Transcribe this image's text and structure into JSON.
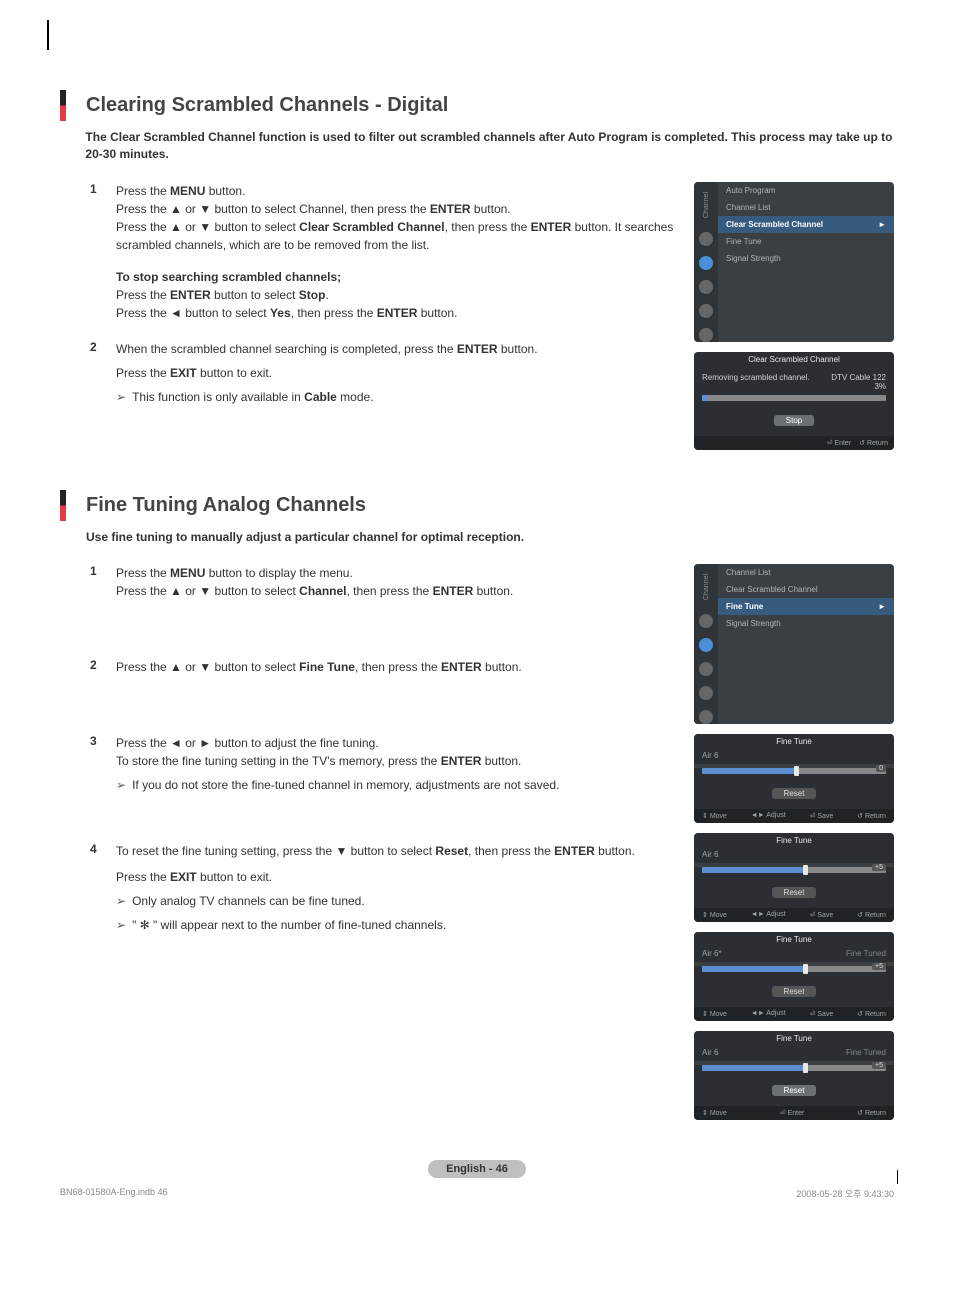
{
  "section1": {
    "title": "Clearing Scrambled Channels - Digital",
    "intro": "The Clear Scrambled Channel function is used to filter out scrambled channels after Auto Program is completed. This process may take up to 20-30 minutes.",
    "steps": {
      "s1": {
        "n": "1",
        "l1a": "Press the ",
        "l1b": "MENU",
        "l1c": " button.",
        "l2a": "Press the ▲ or ▼ button to select Channel, then press the ",
        "l2b": "ENTER",
        "l2c": " button.",
        "l3a": "Press the ▲ or ▼ button to select ",
        "l3b": "Clear Scrambled Channel",
        "l3c": ", then press the ",
        "l3d": "ENTER",
        "l3e": " button. It searches scrambled channels, which are to be removed from the list.",
        "stop_h": "To stop searching scrambled channels;",
        "st1a": "Press the ",
        "st1b": "ENTER",
        "st1c": " button to select ",
        "st1d": "Stop",
        "st1e": ".",
        "st2a": "Press the ◄ button to select ",
        "st2b": "Yes",
        "st2c": ", then press the ",
        "st2d": "ENTER",
        "st2e": " button."
      },
      "s2": {
        "n": "2",
        "l1a": "When the scrambled channel searching is completed, press the ",
        "l1b": "ENTER",
        "l1c": " button.",
        "l2a": "Press the ",
        "l2b": "EXIT",
        "l2c": " button to exit.",
        "note1a": "This function is only available in ",
        "note1b": "Cable",
        "note1c": " mode."
      }
    },
    "osd_menu": {
      "tab": "Channel",
      "items": [
        "Auto Program",
        "Channel List",
        "Clear Scrambled Channel",
        "Fine Tune",
        "Signal Strength"
      ],
      "sel_index": 2,
      "arrow": "►"
    },
    "osd_progress": {
      "title": "Clear Scrambled Channel",
      "msg": "Removing scrambled channel.",
      "ch": "DTV Cable 122",
      "pct": "3%",
      "btn": "Stop",
      "foot_enter": "Enter",
      "foot_return": "Return"
    }
  },
  "section2": {
    "title": "Fine Tuning Analog Channels",
    "intro": "Use fine tuning to manually adjust a particular channel for optimal reception.",
    "steps": {
      "s1": {
        "n": "1",
        "l1a": "Press the ",
        "l1b": "MENU",
        "l1c": " button to display the menu.",
        "l2a": "Press the ▲ or ▼ button to select ",
        "l2b": "Channel",
        "l2c": ", then press the ",
        "l2d": "ENTER",
        "l2e": " button."
      },
      "s2": {
        "n": "2",
        "l1a": "Press the ▲ or ▼ button to select ",
        "l1b": "Fine Tune",
        "l1c": ", then press the ",
        "l1d": "ENTER",
        "l1e": " button."
      },
      "s3": {
        "n": "3",
        "l1a": "Press the ◄ or ► button to adjust the fine tuning.",
        "l2a": "To store the fine tuning setting in the TV's memory, press the ",
        "l2b": "ENTER",
        "l2c": " button.",
        "note": "If you do not store the fine-tuned channel in memory, adjustments are not saved."
      },
      "s4": {
        "n": "4",
        "l1a": "To reset the fine tuning setting, press the ▼ button to select ",
        "l1b": "Reset",
        "l1c": ", then press the ",
        "l1d": "ENTER",
        "l1e": " button.",
        "l2a": "Press the ",
        "l2b": "EXIT",
        "l2c": " button to exit.",
        "note1": "Only analog TV channels can be fine tuned.",
        "note2": "\" ✻ \" will appear next to the number of fine-tuned channels."
      }
    },
    "osd_menu": {
      "tab": "Channel",
      "items": [
        "Channel List",
        "Clear Scrambled Channel",
        "Fine Tune",
        "Signal Strength"
      ],
      "sel_index": 2,
      "arrow": "►"
    },
    "ft_panels": [
      {
        "title": "Fine Tune",
        "ch": "Air 6",
        "status": "",
        "val": "0",
        "fill": 50,
        "reset": "Reset",
        "reset_sel": false,
        "foot": [
          "Move",
          "Adjust",
          "Save",
          "Return"
        ]
      },
      {
        "title": "Fine Tune",
        "ch": "Air 6",
        "status": "",
        "val": "+5",
        "fill": 55,
        "reset": "Reset",
        "reset_sel": false,
        "foot": [
          "Move",
          "Adjust",
          "Save",
          "Return"
        ]
      },
      {
        "title": "Fine Tune",
        "ch": "Air 6*",
        "status": "Fine Tuned",
        "val": "+5",
        "fill": 55,
        "reset": "Reset",
        "reset_sel": false,
        "foot": [
          "Move",
          "Adjust",
          "Save",
          "Return"
        ]
      },
      {
        "title": "Fine Tune",
        "ch": "Air 6",
        "status": "Fine Tuned",
        "val": "+5",
        "fill": 55,
        "reset": "Reset",
        "reset_sel": true,
        "foot": [
          "Move",
          "Enter",
          "Return"
        ]
      }
    ]
  },
  "foot_icons": {
    "updown": "⇕",
    "leftright": "◄►",
    "enter": "⏎",
    "return": "↺"
  },
  "page_label": "English - 46",
  "doc_foot_left": "BN68-01580A-Eng.indb   46",
  "doc_foot_right": "2008-05-28   오후 9:43:30"
}
